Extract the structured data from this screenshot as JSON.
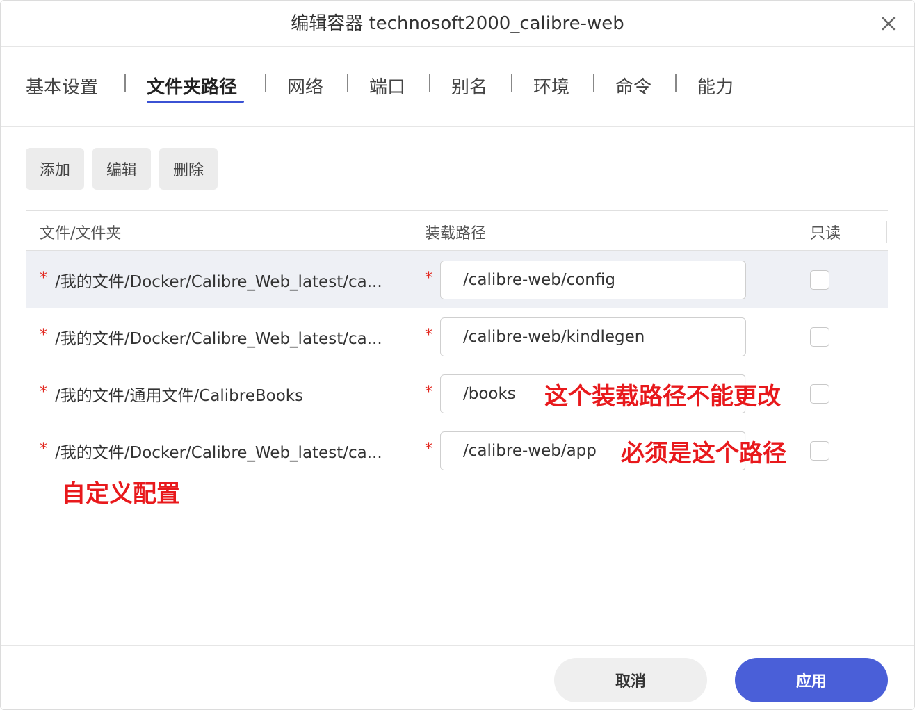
{
  "dialog": {
    "title": "编辑容器 technosoft2000_calibre-web",
    "close_icon": "close-icon"
  },
  "tabs": [
    {
      "label": "基本设置",
      "active": false
    },
    {
      "label": "文件夹路径",
      "active": true
    },
    {
      "label": "网络",
      "active": false
    },
    {
      "label": "端口",
      "active": false
    },
    {
      "label": "别名",
      "active": false
    },
    {
      "label": "环境",
      "active": false
    },
    {
      "label": "命令",
      "active": false
    },
    {
      "label": "能力",
      "active": false
    }
  ],
  "toolbar": {
    "add_label": "添加",
    "edit_label": "编辑",
    "delete_label": "删除"
  },
  "table": {
    "headers": {
      "file": "文件/文件夹",
      "mount": "装载路径",
      "readonly": "只读"
    },
    "required_mark": "*",
    "rows": [
      {
        "file": "/我的文件/Docker/Calibre_Web_latest/ca...",
        "mount": "/calibre-web/config",
        "readonly": false,
        "selected": true
      },
      {
        "file": "/我的文件/Docker/Calibre_Web_latest/ca...",
        "mount": "/calibre-web/kindlegen",
        "readonly": false,
        "selected": false
      },
      {
        "file": "/我的文件/通用文件/CalibreBooks",
        "mount": "/books",
        "readonly": false,
        "selected": false
      },
      {
        "file": "/我的文件/Docker/Calibre_Web_latest/ca...",
        "mount": "/calibre-web/app",
        "readonly": false,
        "selected": false
      }
    ]
  },
  "annotations": {
    "mount_unchangeable": "这个装载路径不能更改",
    "must_be_this_path": "必须是这个路径",
    "custom_config": "自定义配置"
  },
  "footer": {
    "cancel_label": "取消",
    "apply_label": "应用"
  },
  "colors": {
    "accent": "#4a5fd8",
    "annotation": "#e8191c",
    "required": "#e2281f"
  }
}
